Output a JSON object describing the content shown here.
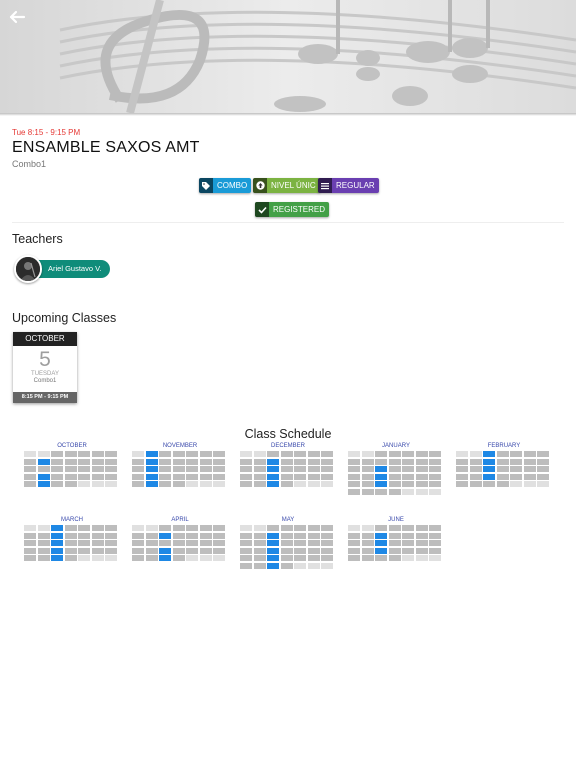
{
  "header": {
    "back_icon": "arrow-left-icon"
  },
  "event": {
    "time": "Tue 8:15 - 9:15 PM",
    "title": "ENSAMBLE SAXOS AMT",
    "subtitle": "Combo1"
  },
  "tags": [
    {
      "label": "COMBO",
      "icon": "tag-icon",
      "color": "#1a9bd7"
    },
    {
      "label": "NIVEL ÚNIC",
      "icon": "arrow-up-circle-icon",
      "color": "#7cb342"
    },
    {
      "label": "REGULAR",
      "icon": "list-icon",
      "color": "#6a3fb1"
    },
    {
      "label": "REGISTERED",
      "icon": "check-icon",
      "color": "#43a047"
    }
  ],
  "teachers": {
    "heading": "Teachers",
    "items": [
      {
        "name": "Ariel Gustavo V."
      }
    ]
  },
  "upcoming": {
    "heading": "Upcoming Classes",
    "card": {
      "month": "OCTOBER",
      "day": "5",
      "weekday": "TUESDAY",
      "course": "Combo1",
      "hours": "8:15 PM - 9:15 PM"
    }
  },
  "schedule": {
    "heading": "Class Schedule",
    "months": [
      {
        "name": "OCTOBER",
        "rows": 5,
        "lead": 0,
        "active_rows": [
          1,
          3,
          4
        ],
        "active_col": 1
      },
      {
        "name": "NOVEMBER",
        "rows": 5,
        "lead": 0,
        "active_rows": [
          0,
          1,
          2,
          3,
          4
        ],
        "active_col": 1
      },
      {
        "name": "DECEMBER",
        "rows": 5,
        "lead": 0,
        "active_rows": [
          1,
          2,
          3,
          4
        ],
        "active_col": 2
      },
      {
        "name": "JANUARY",
        "rows": 6,
        "lead": 0,
        "active_rows": [
          2,
          3,
          4
        ],
        "active_col": 2
      },
      {
        "name": "FEBRUARY",
        "rows": 5,
        "lead": 0,
        "active_rows": [
          0,
          1,
          2,
          3
        ],
        "active_col": 2
      },
      {
        "name": "MARCH",
        "rows": 5,
        "lead": 0,
        "active_rows": [
          0,
          1,
          2,
          3,
          4
        ],
        "active_col": 2
      },
      {
        "name": "APRIL",
        "rows": 5,
        "lead": 0,
        "active_rows": [
          1,
          3,
          4
        ],
        "active_col": 2
      },
      {
        "name": "MAY",
        "rows": 6,
        "lead": 0,
        "active_rows": [
          1,
          2,
          3,
          4,
          5
        ],
        "active_col": 2
      },
      {
        "name": "JUNE",
        "rows": 5,
        "lead": 0,
        "active_rows": [
          1,
          2,
          3
        ],
        "active_col": 2
      }
    ]
  }
}
